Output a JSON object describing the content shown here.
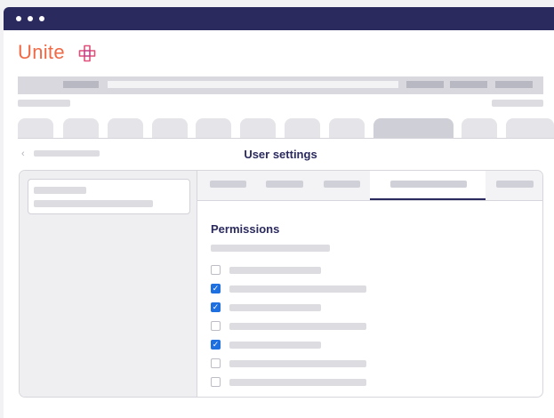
{
  "window": {
    "controls": [
      "dot",
      "dot",
      "dot"
    ]
  },
  "brand": {
    "name": "Unite",
    "icon": "cross-knot-icon",
    "color": "#ef6a47"
  },
  "page": {
    "title": "User settings",
    "back_icon": "chevron-left-icon"
  },
  "permissions": {
    "title": "Permissions",
    "items": [
      {
        "checked": false
      },
      {
        "checked": true
      },
      {
        "checked": true
      },
      {
        "checked": false
      },
      {
        "checked": true
      },
      {
        "checked": false
      },
      {
        "checked": false
      }
    ]
  },
  "colors": {
    "titlebar": "#2b2a5e",
    "accent": "#1e6fe0",
    "heading": "#2b2a5e"
  }
}
